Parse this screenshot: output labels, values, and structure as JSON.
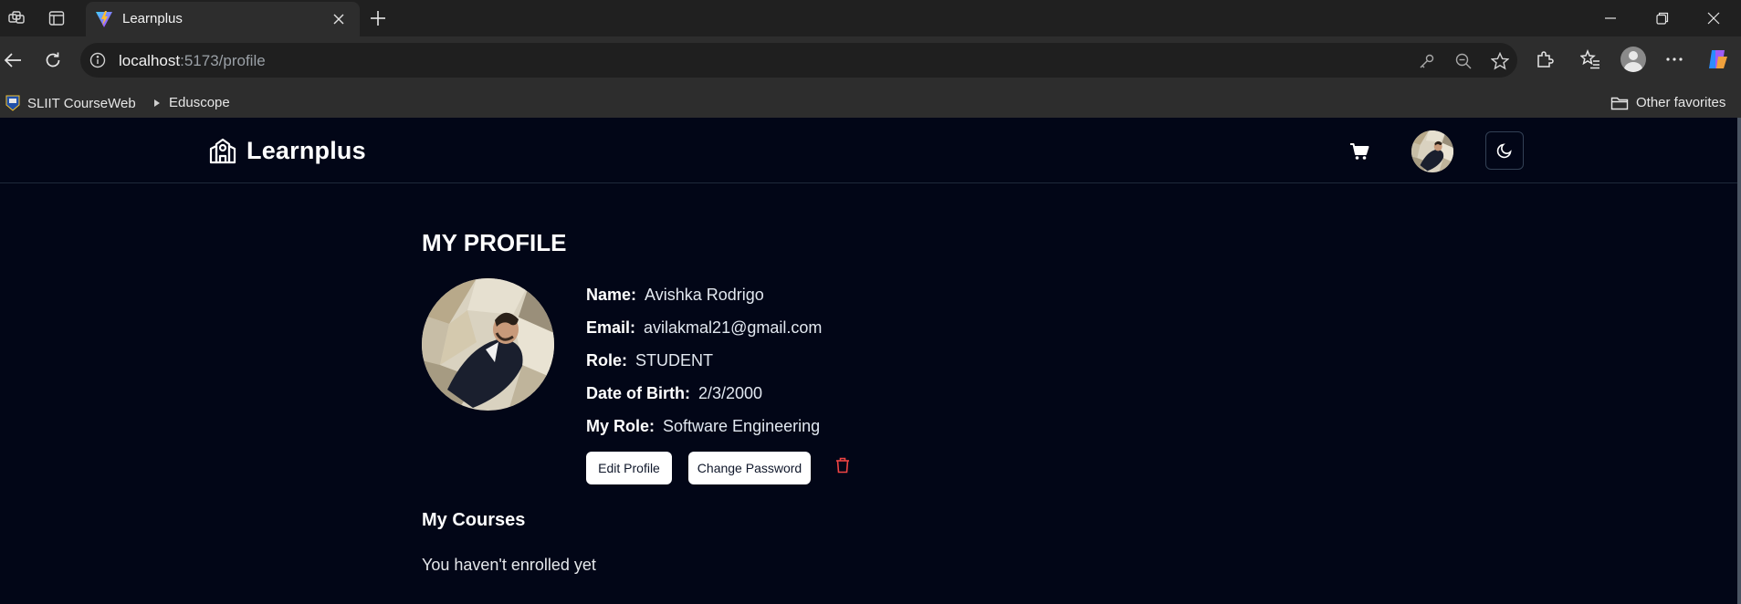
{
  "browser": {
    "tab_title": "Learnplus",
    "url_host": "localhost",
    "url_rest": ":5173/profile",
    "bookmarks": [
      {
        "label": "SLIIT CourseWeb",
        "icon": "sliit-favicon-icon"
      },
      {
        "label": "Eduscope",
        "icon": "play-arrow-icon"
      }
    ],
    "other_favorites": "Other favorites"
  },
  "app": {
    "brand": "Learnplus",
    "colors": {
      "background": "#020617",
      "text": "#ffffff",
      "danger": "#ef4444"
    }
  },
  "profile": {
    "heading": "MY PROFILE",
    "fields": [
      {
        "label": "Name:",
        "value": "Avishka Rodrigo"
      },
      {
        "label": "Email:",
        "value": "avilakmal21@gmail.com"
      },
      {
        "label": "Role:",
        "value": "STUDENT"
      },
      {
        "label": "Date of Birth:",
        "value": "2/3/2000"
      },
      {
        "label": "My Role:",
        "value": "Software Engineering"
      }
    ],
    "edit_label": "Edit Profile",
    "change_password_label": "Change Password"
  },
  "courses": {
    "title": "My Courses",
    "empty_text": "You haven't enrolled yet"
  }
}
